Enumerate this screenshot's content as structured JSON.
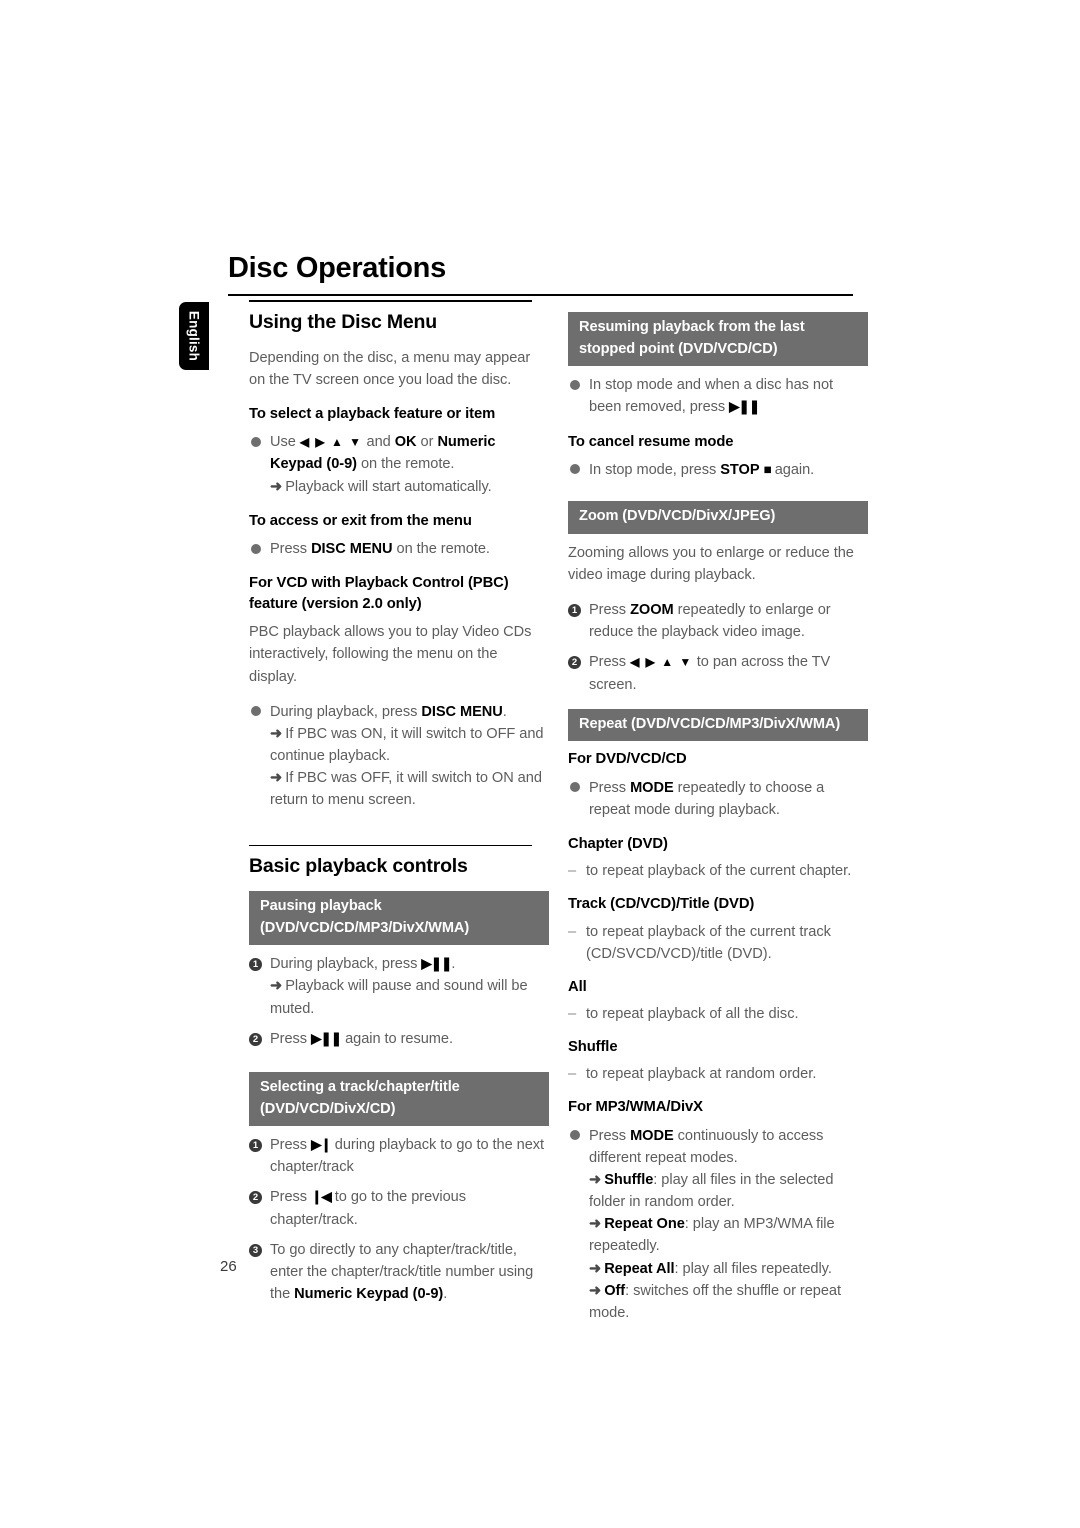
{
  "page": {
    "title": "Disc Operations",
    "language_tab": "English",
    "page_number": "26"
  },
  "left_column": {
    "section1": {
      "heading": "Using the Disc Menu",
      "intro": "Depending on the disc, a menu may appear on the TV screen once you load the disc.",
      "sub1_title": "To select a playback feature or item",
      "sub1_bullet_pre": "Use ",
      "sub1_bullet_arrows": "◀ ▶ ▲ ▼",
      "sub1_bullet_mid": " and ",
      "sub1_bullet_ok": "OK",
      "sub1_bullet_or": " or ",
      "sub1_bullet_keypad": "Numeric Keypad (0-9)",
      "sub1_bullet_post": " on the remote.",
      "sub1_arrow": "Playback will start automatically.",
      "sub2_title": "To access or exit from the menu",
      "sub2_bullet_pre": "Press ",
      "sub2_bullet_key": "DISC MENU",
      "sub2_bullet_post": " on the remote.",
      "sub3_title": "For VCD with Playback Control (PBC) feature (version 2.0 only)",
      "sub3_para": "PBC playback allows you to play Video CDs interactively, following the menu on the display.",
      "sub3_bullet_pre": "During playback, press ",
      "sub3_bullet_key": "DISC MENU",
      "sub3_bullet_post": ".",
      "sub3_arrow1": "If PBC was ON, it will switch to OFF and continue playback.",
      "sub3_arrow2": "If PBC was OFF, it will switch to ON and return to menu screen."
    },
    "section2": {
      "heading": "Basic playback controls",
      "bar1": "Pausing playback (DVD/VCD/CD/MP3/DivX/WMA)",
      "b1_item1_pre": "During playback, press ",
      "b1_item1_glyph": "▶❚❚",
      "b1_item1_post": ".",
      "b1_item1_arrow": "Playback will pause and sound will be muted.",
      "b1_item2_pre": "Press ",
      "b1_item2_glyph": "▶❚❚",
      "b1_item2_post": " again to resume.",
      "bar2": "Selecting a track/chapter/title (DVD/VCD/DivX/CD)",
      "b2_item1_pre": "Press ",
      "b2_item1_glyph": "▶❙",
      "b2_item1_post": " during playback to go to the next chapter/track",
      "b2_item2_pre": "Press ",
      "b2_item2_glyph": "❙◀",
      "b2_item2_post": " to go to the previous chapter/track.",
      "b2_item3_pre": "To go directly to any chapter/track/title, enter the chapter/track/title number using the ",
      "b2_item3_key": "Numeric Keypad (0-9)",
      "b2_item3_post": "."
    }
  },
  "right_column": {
    "bar1": "Resuming playback from the last stopped point (DVD/VCD/CD)",
    "b1_bullet_pre": "In stop mode and when a disc has not been removed, press ",
    "b1_bullet_glyph": "▶❚❚",
    "cancel_title": "To cancel resume mode",
    "cancel_bullet_pre": "In stop mode, press ",
    "cancel_bullet_key": "STOP",
    "cancel_bullet_glyph": "■",
    "cancel_bullet_post": " again.",
    "bar2": "Zoom (DVD/VCD/DivX/JPEG)",
    "zoom_para": "Zooming allows you to enlarge or reduce the video image during playback.",
    "zoom_item1_pre": "Press ",
    "zoom_item1_key": "ZOOM",
    "zoom_item1_post": " repeatedly to enlarge or reduce the playback video image.",
    "zoom_item2_pre": "Press ",
    "zoom_item2_arrows": "◀ ▶ ▲ ▼",
    "zoom_item2_post": " to pan across the TV screen.",
    "bar3": "Repeat (DVD/VCD/CD/MP3/DivX/WMA)",
    "dvd_title": "For DVD/VCD/CD",
    "dvd_bullet_pre": "Press ",
    "dvd_bullet_key": "MODE",
    "dvd_bullet_post": " repeatedly to choose a repeat mode during playback.",
    "mode_chapter_title": "Chapter (DVD)",
    "mode_chapter_desc": "to repeat playback of the current chapter.",
    "mode_track_title": "Track (CD/VCD)/Title (DVD)",
    "mode_track_desc": "to repeat playback of the current track (CD/SVCD/VCD)/title (DVD).",
    "mode_all_title": "All",
    "mode_all_desc": "to repeat playback of all the disc.",
    "mode_shuffle_title": "Shuffle",
    "mode_shuffle_desc": "to repeat playback at random order.",
    "mp3_title": "For MP3/WMA/DivX",
    "mp3_bullet_pre": "Press ",
    "mp3_bullet_key": "MODE",
    "mp3_bullet_post": " continuously to access different repeat modes.",
    "mp3_arrow1_key": "Shuffle",
    "mp3_arrow1_desc": ": play all files in the selected folder in random order.",
    "mp3_arrow2_key": "Repeat One",
    "mp3_arrow2_desc": ": play an MP3/WMA file repeatedly.",
    "mp3_arrow3_key": "Repeat All",
    "mp3_arrow3_desc": ": play all files repeatedly.",
    "mp3_arrow4_key": "Off",
    "mp3_arrow4_desc": ": switches off the shuffle or repeat mode."
  },
  "colors": {
    "bar_gray": "#6e6e6e",
    "body_text": "#5d5d5d",
    "heading_black": "#000000"
  }
}
